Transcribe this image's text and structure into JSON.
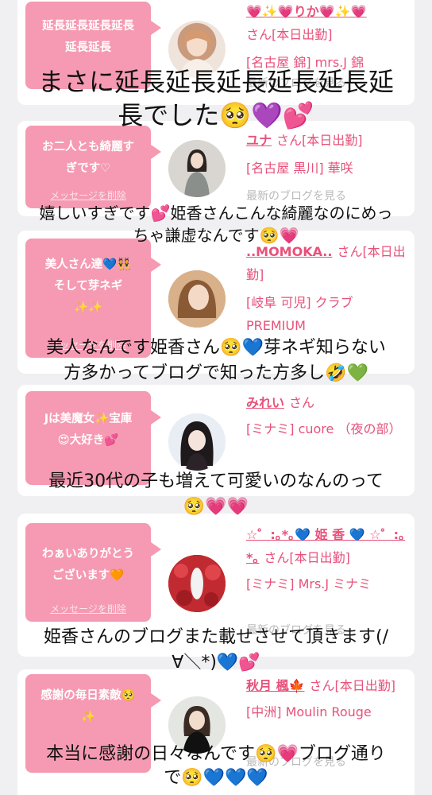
{
  "cards": [
    {
      "message": [
        "延長延長延長延長",
        "延長延長"
      ],
      "delete_label": "メッセージを削除",
      "name": "💗✨💗りか💗✨💗",
      "name_suffix": "さん[本日出勤]",
      "shop": "[名古屋 錦] mrs.J 錦",
      "blog_link": "最新のブログを見る"
    },
    {
      "message": [
        "お二人とも綺麗す",
        "ぎです♡"
      ],
      "delete_label": "メッセージを削除",
      "name": "ユナ",
      "name_suffix": "さん[本日出勤]",
      "shop": "[名古屋 黒川] 華咲",
      "blog_link": "最新のブログを見る"
    },
    {
      "message": [
        "美人さん達💙👯",
        "そして芽ネギ",
        "✨✨"
      ],
      "delete_label": "メッセージを削除",
      "name": "..MOMOKA..",
      "name_suffix": "さん[本日出勤]",
      "shop": "[岐阜 可児] クラブ PREMIUM",
      "blog_link": "最新のブログを見る"
    },
    {
      "message": [
        "Jは美魔女✨宝庫",
        "😍大好き💕"
      ],
      "delete_label": "メッセージを削除",
      "name": "みれい",
      "name_suffix": "さん",
      "shop": "[ミナミ] cuore （夜の部）",
      "blog_link": "最新のブログを見る"
    },
    {
      "message": [
        "わぁいありがとう",
        "ございます🧡"
      ],
      "delete_label": "メッセージを削除",
      "name": "☆゜:｡*｡💙 姫 香 💙 ☆゜:｡*｡",
      "name_suffix": "さん[本日出勤]",
      "shop": "[ミナミ] Mrs.J ミナミ",
      "blog_link": "最新のブログを見る"
    },
    {
      "message": [
        "感謝の毎日素敵🥺",
        "✨"
      ],
      "delete_label": "メッセージを削除",
      "name": "秋月 楓🍁",
      "name_suffix": "さん[本日出勤]",
      "shop": "[中洲] Moulin Rouge",
      "blog_link": "最新のブログを見る"
    }
  ],
  "captions": [
    [
      "まさに延長延長延長延長延長延",
      "長でした🥺💜💕"
    ],
    [
      "嬉しいすぎです💕姫香さんこんな綺麗なのにめっ",
      "ちゃ謙虚なんです🥺💗"
    ],
    [
      "美人なんです姫香さん🥺💙芽ネギ知らない",
      "方多かってブログで知った方多し🤣💚"
    ],
    [
      "最近30代の子も増えて可愛いのなんのって",
      "🥺💗💗"
    ],
    [
      "姫香さんのブログまた載せさせて頂きます(/",
      "∀＼*)💙💕"
    ],
    [
      "本当に感謝の日々なんです🥺💗ブログ通り",
      "で🥺💙💙💙"
    ]
  ],
  "colors": {
    "bubble": "#f59ab2",
    "accent": "#e8517a",
    "background": "#f0f0f2"
  }
}
